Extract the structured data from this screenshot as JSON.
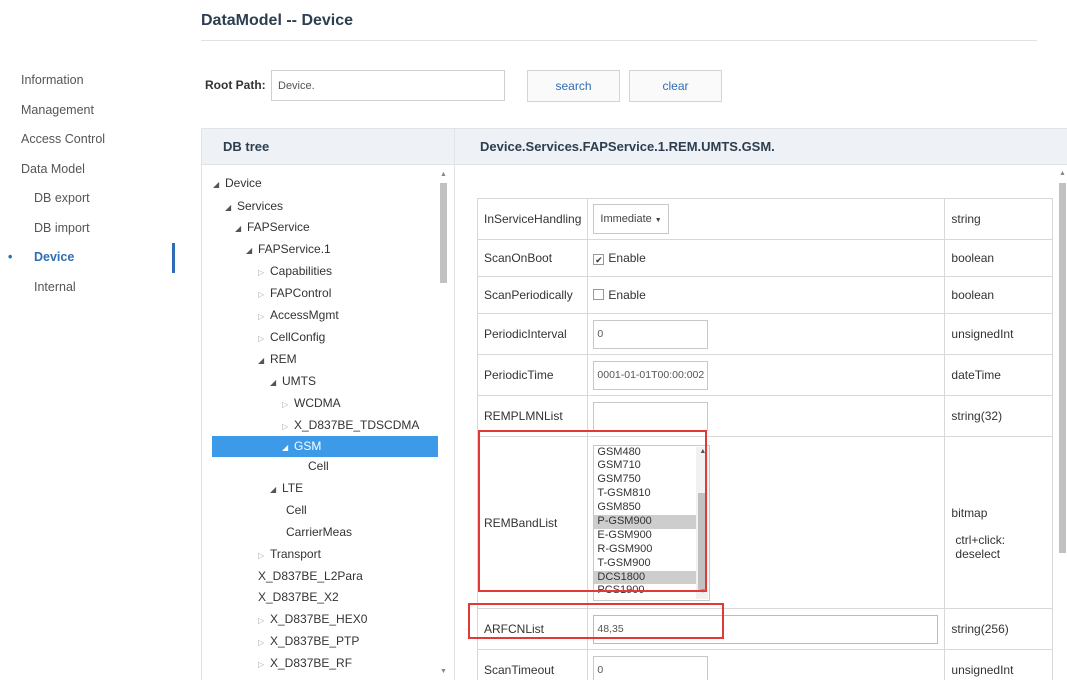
{
  "page": {
    "title": "DataModel -- Device"
  },
  "nav": {
    "items": [
      {
        "label": "Information",
        "sub": false,
        "active": false
      },
      {
        "label": "Management",
        "sub": false,
        "active": false
      },
      {
        "label": "Access Control",
        "sub": false,
        "active": false
      },
      {
        "label": "Data Model",
        "sub": false,
        "active": false
      },
      {
        "label": "DB export",
        "sub": true,
        "active": false
      },
      {
        "label": "DB import",
        "sub": true,
        "active": false
      },
      {
        "label": "Device",
        "sub": true,
        "active": true
      },
      {
        "label": "Internal",
        "sub": true,
        "active": false
      }
    ],
    "active_bullet": "•"
  },
  "root": {
    "label": "Root Path:",
    "value": "Device.",
    "search_label": "search",
    "clear_label": "clear"
  },
  "tree": {
    "header": "DB tree",
    "rows": [
      {
        "label": "Device",
        "expanded": true
      },
      {
        "label": "Services",
        "expanded": true
      },
      {
        "label": "FAPService",
        "expanded": true
      },
      {
        "label": "FAPService.1",
        "expanded": true
      },
      {
        "label": "Capabilities",
        "expanded": false
      },
      {
        "label": "FAPControl",
        "expanded": false
      },
      {
        "label": "AccessMgmt",
        "expanded": false
      },
      {
        "label": "CellConfig",
        "expanded": false
      },
      {
        "label": "REM",
        "expanded": true
      },
      {
        "label": "UMTS",
        "expanded": true
      },
      {
        "label": "WCDMA",
        "expanded": false
      },
      {
        "label": "X_D837BE_TDSCDMA",
        "expanded": false
      },
      {
        "label": "GSM",
        "expanded": true,
        "selected": true
      },
      {
        "label": "Cell",
        "leaf": true
      },
      {
        "label": "LTE",
        "expanded": true
      },
      {
        "label": "Cell",
        "leaf": true
      },
      {
        "label": "CarrierMeas",
        "leaf": true
      },
      {
        "label": "Transport",
        "expanded": false
      },
      {
        "label": "X_D837BE_L2Para",
        "leaf": true
      },
      {
        "label": "X_D837BE_X2",
        "leaf": true
      },
      {
        "label": "X_D837BE_HEX0",
        "expanded": false
      },
      {
        "label": "X_D837BE_PTP",
        "expanded": false
      },
      {
        "label": "X_D837BE_RF",
        "expanded": false
      }
    ]
  },
  "detail": {
    "path": "Device.Services.FAPService.1.REM.UMTS.GSM.",
    "params": {
      "in_service_handling": {
        "name": "InServiceHandling",
        "value": "Immediate",
        "type": "string"
      },
      "scan_on_boot": {
        "name": "ScanOnBoot",
        "checkbox_label": "Enable",
        "checked": true,
        "type": "boolean"
      },
      "scan_periodically": {
        "name": "ScanPeriodically",
        "checkbox_label": "Enable",
        "checked": false,
        "type": "boolean"
      },
      "periodic_interval": {
        "name": "PeriodicInterval",
        "value": "0",
        "type": "unsignedInt"
      },
      "periodic_time": {
        "name": "PeriodicTime",
        "value": "0001-01-01T00:00:002",
        "type": "dateTime"
      },
      "rem_plmn_list": {
        "name": "REMPLMNList",
        "value": "",
        "type": "string(32)"
      },
      "rem_band_list": {
        "name": "REMBandList",
        "type": "bitmap",
        "hint": "ctrl+click: deselect",
        "options": [
          {
            "label": "GSM480",
            "selected": false
          },
          {
            "label": "GSM710",
            "selected": false
          },
          {
            "label": "GSM750",
            "selected": false
          },
          {
            "label": "T-GSM810",
            "selected": false
          },
          {
            "label": "GSM850",
            "selected": false
          },
          {
            "label": "P-GSM900",
            "selected": true
          },
          {
            "label": "E-GSM900",
            "selected": false
          },
          {
            "label": "R-GSM900",
            "selected": false
          },
          {
            "label": "T-GSM900",
            "selected": false
          },
          {
            "label": "DCS1800",
            "selected": true
          },
          {
            "label": "PCS1900",
            "selected": false
          }
        ]
      },
      "arfcn_list": {
        "name": "ARFCNList",
        "value": "48,35",
        "type": "string(256)"
      },
      "scan_timeout": {
        "name": "ScanTimeout",
        "value": "0",
        "type": "unsignedInt"
      }
    }
  },
  "glyphs": {
    "expanded": "◢",
    "collapsed": "▷",
    "caret": "▼",
    "check": "✔",
    "up": "▲",
    "down": "▼"
  },
  "colors": {
    "accent": "#2f6db5",
    "selected_row": "#3d9ae8",
    "highlight": "#e13838"
  }
}
